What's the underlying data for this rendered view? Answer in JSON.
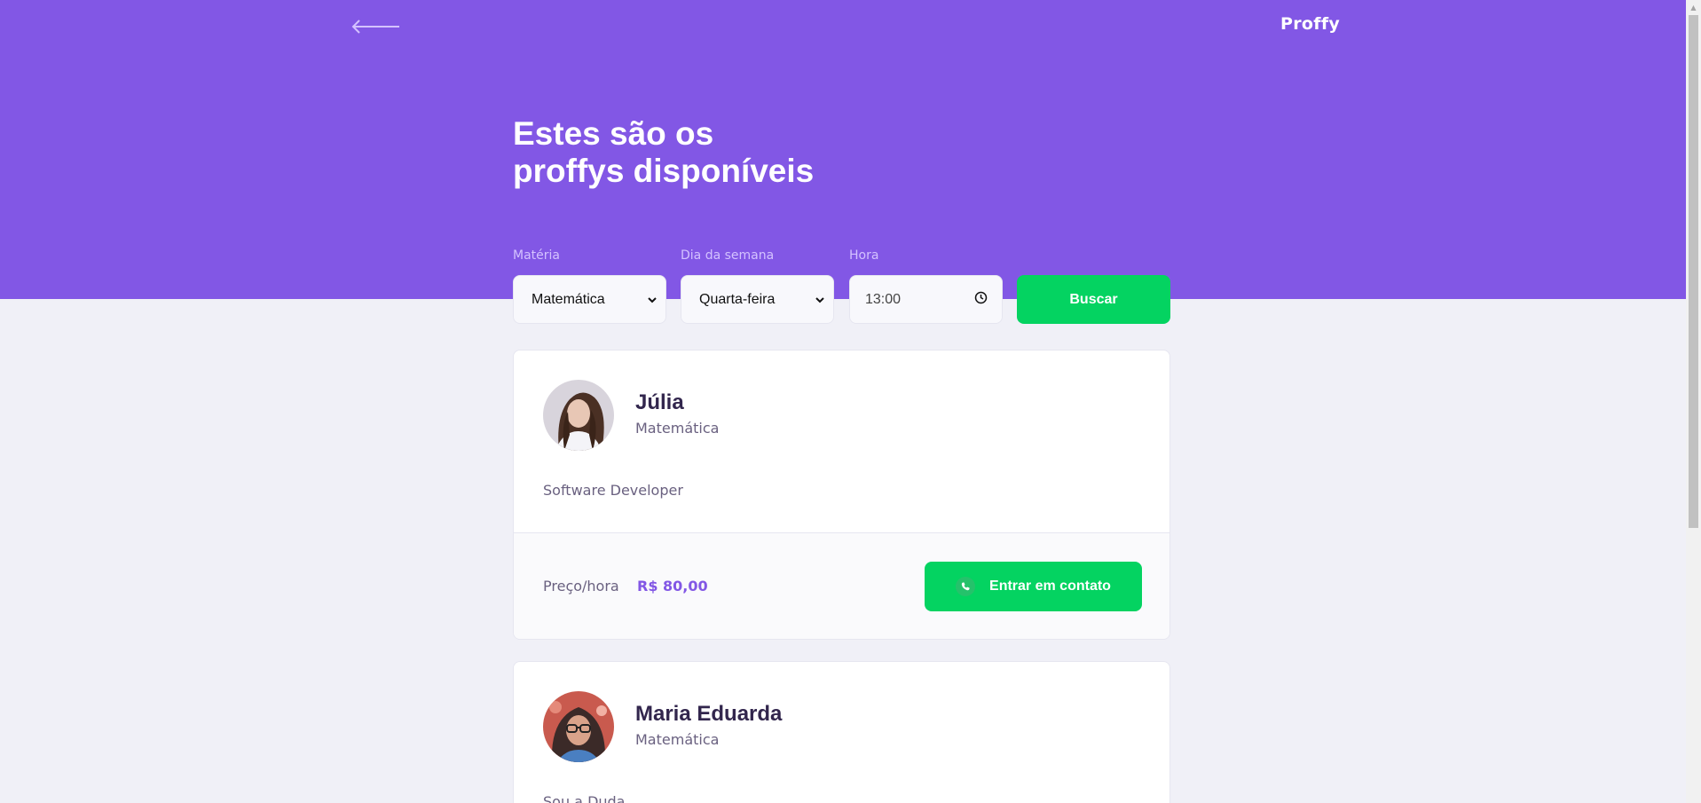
{
  "header": {
    "logo": "Proffy",
    "back_icon": "arrow-left-icon",
    "title_line1": "Estes são os",
    "title_line2": "proffys disponíveis",
    "background_color": "#8257E5"
  },
  "filters": {
    "subject_label": "Matéria",
    "subject_value": "Matemática",
    "weekday_label": "Dia da semana",
    "weekday_value": "Quarta-feira",
    "time_label": "Hora",
    "time_value": "13:00",
    "time_icon": "clock-icon",
    "search_label": "Buscar"
  },
  "teachers": [
    {
      "name": "Júlia",
      "subject": "Matemática",
      "bio": "Software Developer",
      "price_label": "Preço/hora",
      "price": "R$ 80,00",
      "contact_label": "Entrar em contato",
      "contact_icon": "whatsapp-icon"
    },
    {
      "name": "Maria Eduarda",
      "subject": "Matemática",
      "bio": "Sou a Duda"
    }
  ],
  "colors": {
    "primary": "#8257E5",
    "success": "#04D361",
    "background": "#F0F0F7"
  }
}
